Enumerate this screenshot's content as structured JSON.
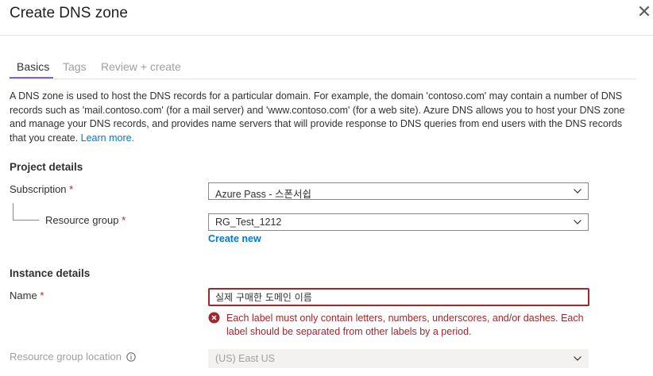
{
  "header": {
    "title": "Create DNS zone",
    "close_icon": "close-icon"
  },
  "tabs": [
    {
      "label": "Basics",
      "active": true
    },
    {
      "label": "Tags",
      "active": false
    },
    {
      "label": "Review + create",
      "active": false
    }
  ],
  "description": {
    "text": "A DNS zone is used to host the DNS records for a particular domain. For example, the domain 'contoso.com' may contain a number of DNS records such as 'mail.contoso.com' (for a mail server) and 'www.contoso.com' (for a web site). Azure DNS allows you to host your DNS zone and manage your DNS records, and provides name servers that will provide response to DNS queries from end users with the DNS records that you create.",
    "link": "Learn more."
  },
  "project": {
    "heading": "Project details",
    "subscription_label": "Subscription",
    "subscription_value": "Azure Pass - 스폰서쉽",
    "resource_group_label": "Resource group",
    "resource_group_value": "RG_Test_1212",
    "create_new": "Create new"
  },
  "instance": {
    "heading": "Instance details",
    "name_label": "Name",
    "name_value": "실제 구매한 도메인 이름",
    "error": "Each label must only contain letters, numbers, underscores, and/or dashes. Each label should be separated from other labels by a period.",
    "location_label": "Resource group location",
    "location_value": "(US) East US"
  },
  "required_marker": "*",
  "colors": {
    "accent": "#8764b8",
    "link": "#0078d4",
    "error": "#a4262c"
  }
}
